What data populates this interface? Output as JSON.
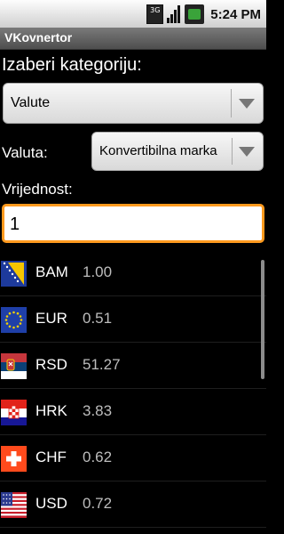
{
  "status_bar": {
    "time": "5:24 PM",
    "network": "3G"
  },
  "title_bar": {
    "title": "VKovnertor"
  },
  "category": {
    "label": "Izaberi kategoriju:",
    "selected": "Valute"
  },
  "currency": {
    "label": "Valuta:",
    "selected": "Konvertibilna marka"
  },
  "value": {
    "label": "Vrijednost:",
    "input": "1"
  },
  "rates": [
    {
      "code": "BAM",
      "value": "1.00",
      "flag": "flag-bosnia-icon"
    },
    {
      "code": "EUR",
      "value": "0.51",
      "flag": "flag-eu-icon"
    },
    {
      "code": "RSD",
      "value": "51.27",
      "flag": "flag-serbia-icon"
    },
    {
      "code": "HRK",
      "value": "3.83",
      "flag": "flag-croatia-icon"
    },
    {
      "code": "CHF",
      "value": "0.62",
      "flag": "flag-switzerland-icon"
    },
    {
      "code": "USD",
      "value": "0.72",
      "flag": "flag-usa-icon"
    }
  ],
  "colors": {
    "input_focus": "#ff9a1e",
    "background": "#000000"
  }
}
